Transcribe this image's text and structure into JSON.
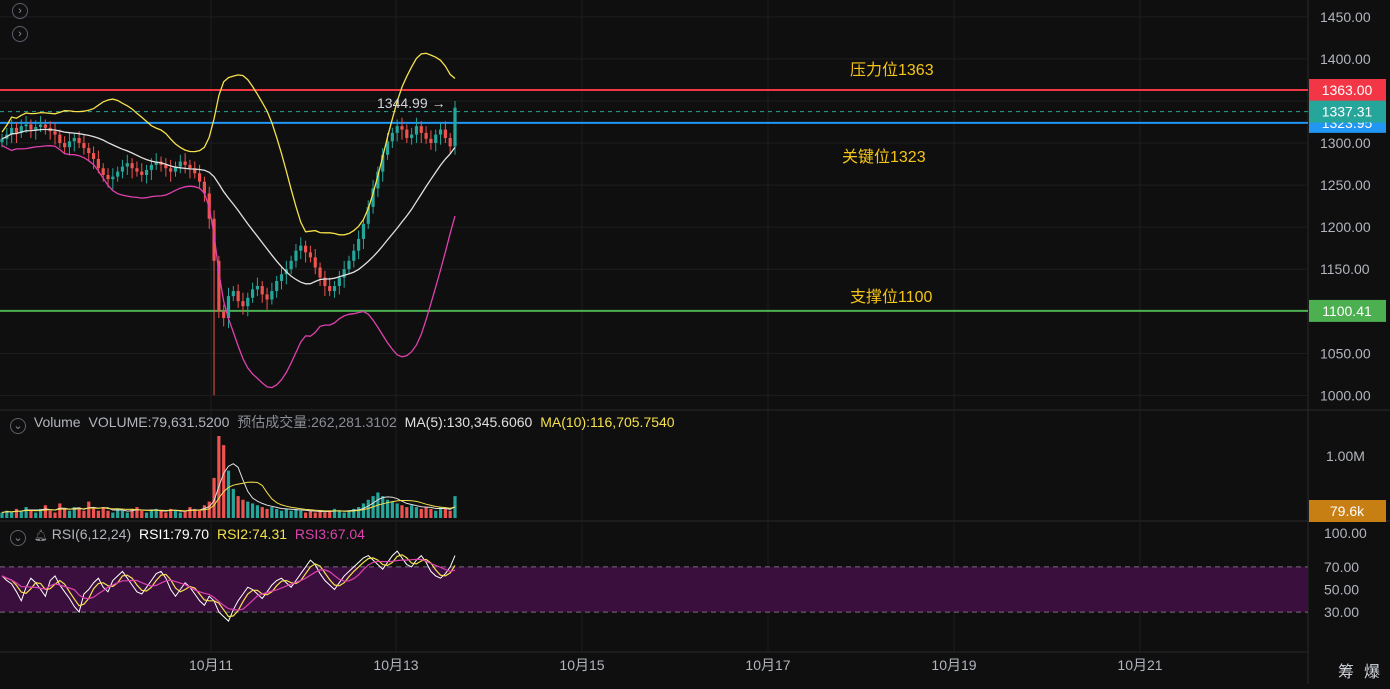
{
  "colors": {
    "background": "#0f0f0f",
    "grid": "#1e1e1e",
    "up": "#26a69a",
    "down": "#ef5350",
    "axis_text": "#b2b5be",
    "resistance": "#f23645",
    "key": "#2196f3",
    "support": "#4caf50",
    "boll_upper": "#f5e14b",
    "boll_mid": "#e0e0e0",
    "boll_lower": "#e040b0",
    "annotation": "#f5c518",
    "rsi_band": "#3a0f3e"
  },
  "icons": {
    "collapse_top": "chevron-right-circle-icon",
    "collapse_second": "chevron-right-circle-icon",
    "volume_toggle": "chevron-down-circle-icon",
    "rsi_toggle": "chevron-down-circle-icon",
    "rsi_alert": "bell-icon"
  },
  "icon_glyphs": {
    "chevron_right": "›",
    "chevron_down": "⌄",
    "bell": "🔔"
  },
  "price_axis": {
    "ticks": [
      "1450.00",
      "1400.00",
      "1363.00",
      "1337.31",
      "1300.00",
      "1250.00",
      "1200.00",
      "1150.00",
      "1100.41",
      "1050.00",
      "1000.00"
    ],
    "ylim": [
      985,
      1470
    ]
  },
  "price_labels": {
    "resistance": {
      "text": "1363.00",
      "value": 1363.0,
      "color": "#f23645"
    },
    "last": {
      "text": "1337.31",
      "value": 1337.31,
      "color": "#26a69a"
    },
    "key": {
      "text": "1323.95",
      "value": 1323.95,
      "color": "#2196f3"
    },
    "support": {
      "text": "1100.41",
      "value": 1100.41,
      "color": "#4caf50"
    }
  },
  "annotations": {
    "resistance": "压力位1363",
    "key": "关键位1323",
    "support": "支撑位1100",
    "high_marker": "1344.99"
  },
  "volume_panel": {
    "name": "Volume",
    "volume": "VOLUME:79,631.5200",
    "forecast": "预估成交量:262,281.3102",
    "ma5": "MA(5):130,345.6060",
    "ma10": "MA(10):116,705.7540",
    "axis_tick": "1.00M",
    "last_label": "79.6k",
    "last_label_color": "#c77e12"
  },
  "rsi_panel": {
    "name": "RSI(6,12,24)",
    "rsi1": "RSI1:79.70",
    "rsi2": "RSI2:74.31",
    "rsi3": "RSI3:67.04",
    "ticks": [
      "100.00",
      "70.00",
      "50.00",
      "30.00"
    ]
  },
  "time_axis": {
    "ticks": [
      "10月11",
      "10月13",
      "10月15",
      "10月17",
      "10月19",
      "10月21"
    ]
  },
  "corner_text": {
    "left": "筹",
    "right": "爆"
  },
  "chart_data": {
    "type": "line",
    "title": "",
    "xlabel": "",
    "ylabel": "",
    "ylim": [
      985,
      1470
    ],
    "grid": true,
    "horizontal_lines": [
      {
        "name": "压力位1363",
        "value": 1363.0
      },
      {
        "name": "关键位1323",
        "value": 1323.95
      },
      {
        "name": "支撑位1100",
        "value": 1100.41
      }
    ],
    "series": [
      {
        "name": "close",
        "values": [
          1305,
          1310,
          1318,
          1312,
          1320,
          1322,
          1316,
          1319,
          1322,
          1318,
          1314,
          1310,
          1300,
          1295,
          1302,
          1306,
          1300,
          1294,
          1288,
          1281,
          1270,
          1262,
          1257,
          1260,
          1266,
          1272,
          1276,
          1270,
          1266,
          1262,
          1268,
          1274,
          1278,
          1274,
          1270,
          1266,
          1272,
          1278,
          1274,
          1270,
          1264,
          1254,
          1240,
          1210,
          1160,
          1100,
          1092,
          1118,
          1124,
          1112,
          1106,
          1116,
          1126,
          1130,
          1120,
          1114,
          1124,
          1136,
          1144,
          1150,
          1160,
          1172,
          1178,
          1170,
          1164,
          1152,
          1140,
          1130,
          1124,
          1130,
          1140,
          1150,
          1160,
          1172,
          1186,
          1204,
          1224,
          1246,
          1266,
          1286,
          1302,
          1312,
          1320,
          1316,
          1306,
          1310,
          1320,
          1312,
          1305,
          1300,
          1310,
          1316,
          1306,
          1296,
          1342
        ]
      }
    ]
  },
  "volume_data": [
    3,
    4,
    3,
    5,
    4,
    6,
    4,
    3,
    5,
    7,
    4,
    3,
    8,
    5,
    4,
    6,
    5,
    4,
    9,
    5,
    4,
    6,
    4,
    3,
    5,
    4,
    3,
    5,
    6,
    4,
    3,
    4,
    5,
    4,
    3,
    5,
    4,
    3,
    4,
    6,
    5,
    4,
    7,
    9,
    22,
    45,
    40,
    26,
    16,
    12,
    10,
    9,
    8,
    7,
    6,
    5,
    6,
    5,
    4,
    5,
    4,
    5,
    4,
    3,
    4,
    3,
    4,
    3,
    4,
    5,
    4,
    3,
    4,
    5,
    6,
    8,
    10,
    12,
    14,
    12,
    10,
    9,
    8,
    7,
    6,
    7,
    6,
    5,
    6,
    5,
    4,
    6,
    5,
    4,
    12
  ],
  "rsi_data": [
    62,
    58,
    55,
    48,
    40,
    52,
    60,
    56,
    50,
    44,
    58,
    62,
    54,
    48,
    42,
    35,
    30,
    46,
    50,
    56,
    60,
    52,
    48,
    58,
    62,
    66,
    60,
    54,
    48,
    46,
    52,
    58,
    64,
    66,
    60,
    50,
    44,
    50,
    56,
    52,
    46,
    40,
    36,
    44,
    40,
    30,
    26,
    22,
    32,
    40,
    46,
    52,
    50,
    46,
    42,
    48,
    54,
    58,
    60,
    56,
    52,
    58,
    64,
    70,
    76,
    72,
    64,
    58,
    54,
    50,
    56,
    62,
    66,
    70,
    74,
    78,
    80,
    76,
    72,
    68,
    74,
    80,
    84,
    78,
    72,
    70,
    76,
    80,
    74,
    66,
    62,
    60,
    64,
    70,
    80
  ]
}
